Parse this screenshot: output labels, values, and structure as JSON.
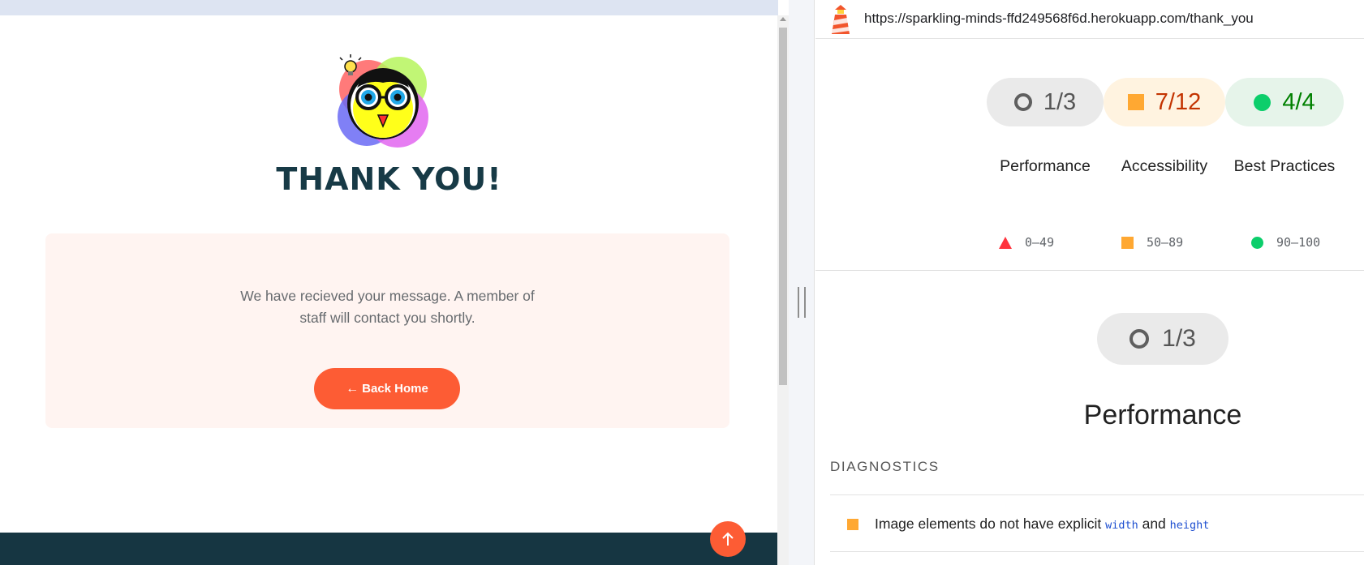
{
  "page": {
    "heading": "THANK YOU!",
    "message": "We have recieved your message. A member of staff will contact you shortly.",
    "back_button": {
      "arrow": "←",
      "label": "Back Home"
    },
    "logo_icon": "owl-logo-icon",
    "scroll_top_icon": "arrow-up-icon",
    "colors": {
      "accent": "#fd5c34",
      "heading": "#173a46",
      "card_bg": "#fff4f1",
      "footer": "#163642"
    }
  },
  "report": {
    "url": "https://sparkling-minds-ffd249568f6d.herokuapp.com/thank_you",
    "gauges": [
      {
        "score": "1/3",
        "label": "Performance",
        "status": "neutral"
      },
      {
        "score": "7/12",
        "label": "Accessibility",
        "status": "average"
      },
      {
        "score": "4/4",
        "label": "Best Practices",
        "status": "pass"
      }
    ],
    "legend": [
      {
        "range": "0–49",
        "shape": "triangle",
        "color": "#ff333d"
      },
      {
        "range": "50–89",
        "shape": "square",
        "color": "#ffa832"
      },
      {
        "range": "90–100",
        "shape": "circle",
        "color": "#0cce6b"
      }
    ],
    "category": {
      "score": "1/3",
      "title": "Performance"
    },
    "diagnostics": {
      "heading": "DIAGNOSTICS",
      "audits": [
        {
          "text_before": "Image elements do not have explicit",
          "code1": "width",
          "text_middle": "and",
          "code2": "height"
        }
      ]
    }
  }
}
